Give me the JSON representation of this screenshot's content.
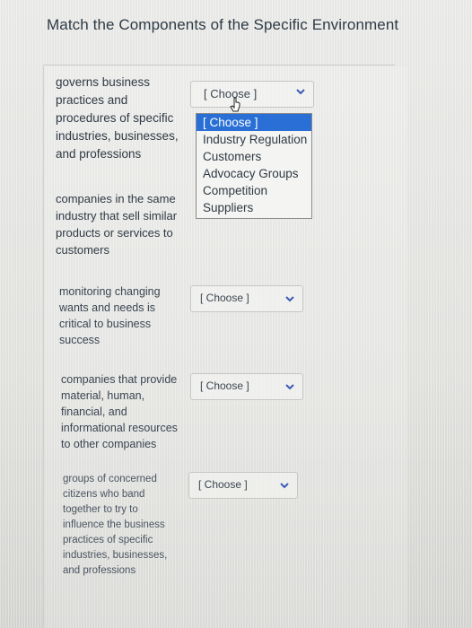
{
  "title": "Match the Components of the Specific Environment",
  "items": [
    {
      "prompt": "governs business practices and procedures of specific industries, businesses, and professions",
      "selected": "[ Choose ]"
    },
    {
      "prompt": "companies in the same industry that sell similar products or services to customers",
      "selected": "[ Choose ]"
    },
    {
      "prompt": "monitoring changing wants and needs is critical to business success",
      "selected": "[ Choose ]"
    },
    {
      "prompt": "companies that provide material, human, financial, and informational resources to other companies",
      "selected": "[ Choose ]"
    },
    {
      "prompt": "groups of concerned citizens who band together to try to influence the business practices of specific industries, businesses, and professions",
      "selected": "[ Choose ]"
    }
  ],
  "dropdown_options": [
    "[ Choose ]",
    "Industry Regulation",
    "Customers",
    "Advocacy Groups",
    "Competition",
    "Suppliers"
  ],
  "highlight_color": "#2a6fd6"
}
